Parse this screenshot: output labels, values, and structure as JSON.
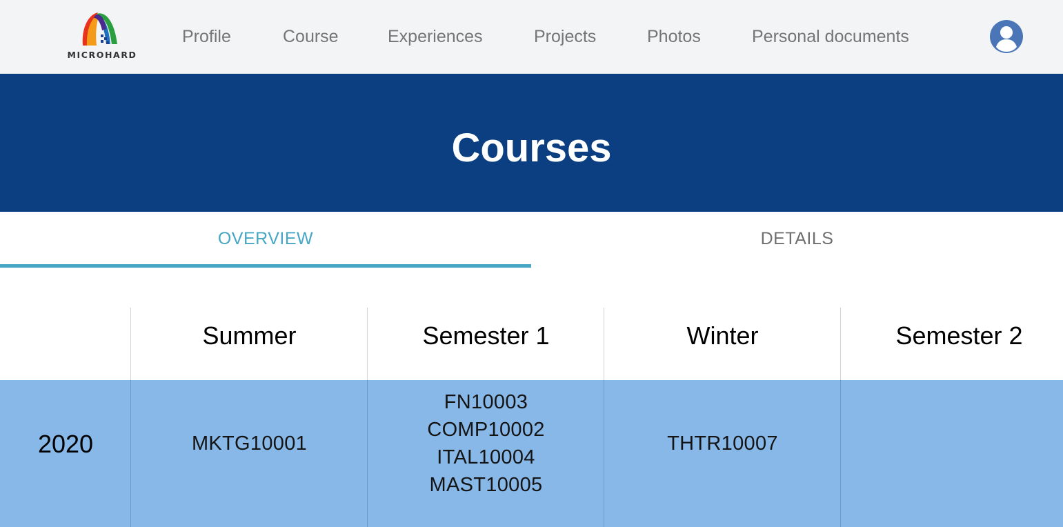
{
  "header": {
    "logo_text": "MICROHARD",
    "nav": [
      {
        "label": "Profile"
      },
      {
        "label": "Course"
      },
      {
        "label": "Experiences"
      },
      {
        "label": "Projects"
      },
      {
        "label": "Photos"
      },
      {
        "label": "Personal documents"
      }
    ],
    "avatar_icon": "user-circle-icon",
    "accent_color": "#4a76b8"
  },
  "banner": {
    "title": "Courses",
    "background_color": "#0b3f81"
  },
  "tabs": [
    {
      "label": "OVERVIEW",
      "active": true
    },
    {
      "label": "DETAILS",
      "active": false
    }
  ],
  "table": {
    "columns": [
      "",
      "Summer",
      "Semester 1",
      "Winter",
      "Semester 2"
    ],
    "rows": [
      {
        "year": "2020",
        "summer": [
          "MKTG10001"
        ],
        "semester1": [
          "FN10003",
          "COMP10002",
          "ITAL10004",
          "MAST10005"
        ],
        "winter": [
          "THTR10007"
        ],
        "semester2": []
      }
    ],
    "row_color": "#88b8e8"
  }
}
